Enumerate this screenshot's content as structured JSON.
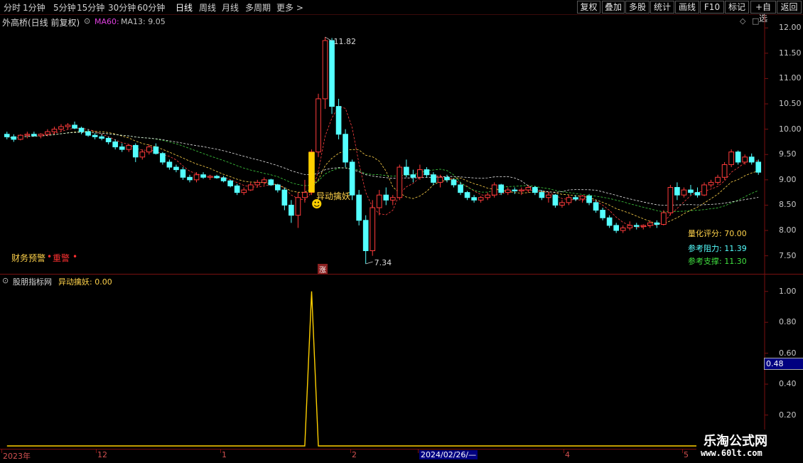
{
  "toolbar": {
    "periods": [
      "分时",
      "1分钟",
      "5分钟",
      "15分钟",
      "30分钟",
      "60分钟",
      "日线",
      "周线",
      "月线",
      "多周期",
      "更多 >"
    ],
    "active_period": "日线",
    "buttons": [
      "复权",
      "叠加",
      "多股",
      "统计",
      "画线",
      "F10",
      "标记",
      "+自选",
      "返回"
    ]
  },
  "main": {
    "title": "外高桥(日线 前复权)",
    "ma_label": "MA60:",
    "ma_value": "MA13: 9.05",
    "high_label": "11.82",
    "low_label": "7.34",
    "signal_label": "异动擒妖",
    "warning_label": "财务预警",
    "warning_value": "重警",
    "badge": "涨",
    "score_label": "量化评分: 70.00",
    "resistance_label": "参考阻力: 11.39",
    "support_label": "参考支撑: 11.30",
    "y_ticks": [
      "12.00",
      "11.50",
      "11.00",
      "10.50",
      "10.00",
      "9.50",
      "9.00",
      "8.50",
      "8.00",
      "7.50"
    ]
  },
  "sub": {
    "title": "股朋指标网",
    "series_label": "异动擒妖: 0.00",
    "y_ticks": [
      "1.00",
      "0.80",
      "0.60",
      "0.40",
      "0.20"
    ],
    "cursor_value": "0.48"
  },
  "date_axis": {
    "labels": [
      "2023年",
      "12",
      "1",
      "2",
      "2024/02/26/—",
      "4",
      "5"
    ]
  },
  "watermark": {
    "title": "乐淘公式网",
    "url": "www.60lt.com"
  },
  "colors": {
    "up": "#ff3b3b",
    "down": "#54ffff",
    "signal": "#ffd000",
    "ma1": "#e8e8e8",
    "ma2": "#ffd24a",
    "ma3": "#40d040",
    "ma4": "#ff4040"
  },
  "chart_data": {
    "type": "candlestick",
    "ylim": [
      7.2,
      12.2
    ],
    "candles": [
      [
        9.9,
        9.95,
        9.8,
        9.85
      ],
      [
        9.85,
        9.9,
        9.75,
        9.8
      ],
      [
        9.8,
        9.9,
        9.78,
        9.88
      ],
      [
        9.88,
        9.95,
        9.82,
        9.9
      ],
      [
        9.9,
        9.95,
        9.85,
        9.87
      ],
      [
        9.87,
        9.92,
        9.82,
        9.9
      ],
      [
        9.9,
        10.0,
        9.86,
        9.95
      ],
      [
        9.95,
        10.05,
        9.9,
        10.0
      ],
      [
        10.0,
        10.1,
        9.95,
        10.05
      ],
      [
        10.05,
        10.12,
        10.0,
        10.08
      ],
      [
        10.08,
        10.15,
        10.0,
        10.02
      ],
      [
        10.02,
        10.05,
        9.9,
        9.95
      ],
      [
        9.95,
        10.0,
        9.85,
        9.88
      ],
      [
        9.88,
        9.92,
        9.8,
        9.85
      ],
      [
        9.85,
        9.9,
        9.78,
        9.82
      ],
      [
        9.82,
        9.85,
        9.7,
        9.75
      ],
      [
        9.75,
        9.8,
        9.6,
        9.65
      ],
      [
        9.65,
        9.72,
        9.55,
        9.6
      ],
      [
        9.6,
        9.7,
        9.55,
        9.68
      ],
      [
        9.68,
        9.72,
        9.35,
        9.45
      ],
      [
        9.45,
        9.6,
        9.4,
        9.55
      ],
      [
        9.55,
        9.7,
        9.5,
        9.65
      ],
      [
        9.65,
        9.72,
        9.5,
        9.52
      ],
      [
        9.52,
        9.55,
        9.3,
        9.35
      ],
      [
        9.35,
        9.4,
        9.2,
        9.25
      ],
      [
        9.25,
        9.3,
        9.15,
        9.2
      ],
      [
        9.2,
        9.25,
        9.0,
        9.05
      ],
      [
        9.05,
        9.1,
        8.95,
        9.0
      ],
      [
        9.0,
        9.15,
        8.95,
        9.1
      ],
      [
        9.1,
        9.15,
        9.02,
        9.05
      ],
      [
        9.05,
        9.1,
        9.0,
        9.07
      ],
      [
        9.07,
        9.1,
        9.02,
        9.04
      ],
      [
        9.04,
        9.08,
        8.95,
        8.98
      ],
      [
        8.98,
        9.0,
        8.85,
        8.88
      ],
      [
        8.88,
        8.92,
        8.7,
        8.75
      ],
      [
        8.75,
        8.85,
        8.7,
        8.8
      ],
      [
        8.8,
        8.95,
        8.78,
        8.9
      ],
      [
        8.9,
        9.0,
        8.85,
        8.95
      ],
      [
        8.95,
        9.05,
        8.9,
        9.0
      ],
      [
        9.0,
        9.02,
        8.88,
        8.9
      ],
      [
        8.9,
        8.92,
        8.75,
        8.8
      ],
      [
        8.8,
        8.85,
        8.4,
        8.5
      ],
      [
        8.5,
        8.6,
        8.15,
        8.3
      ],
      [
        8.3,
        8.75,
        8.05,
        8.65
      ],
      [
        8.65,
        9.0,
        8.55,
        8.75
      ],
      [
        8.75,
        9.6,
        8.7,
        9.55
      ],
      [
        9.55,
        10.7,
        9.45,
        10.6
      ],
      [
        10.6,
        11.82,
        10.4,
        11.75
      ],
      [
        11.75,
        11.8,
        10.3,
        10.45
      ],
      [
        10.45,
        10.6,
        9.8,
        9.9
      ],
      [
        9.9,
        10.0,
        9.25,
        9.35
      ],
      [
        9.35,
        9.4,
        8.6,
        8.7
      ],
      [
        8.7,
        8.8,
        8.1,
        8.2
      ],
      [
        8.2,
        8.3,
        7.34,
        7.6
      ],
      [
        7.6,
        8.6,
        7.5,
        8.45
      ],
      [
        8.45,
        8.8,
        8.3,
        8.7
      ],
      [
        8.7,
        8.85,
        8.5,
        8.6
      ],
      [
        8.6,
        8.7,
        8.5,
        8.65
      ],
      [
        8.65,
        9.3,
        8.6,
        9.25
      ],
      [
        9.25,
        9.4,
        9.05,
        9.1
      ],
      [
        9.1,
        9.2,
        8.95,
        9.05
      ],
      [
        9.05,
        9.3,
        9.0,
        9.2
      ],
      [
        9.2,
        9.25,
        9.05,
        9.1
      ],
      [
        9.1,
        9.15,
        8.9,
        8.95
      ],
      [
        8.95,
        9.1,
        8.85,
        9.05
      ],
      [
        9.05,
        9.1,
        8.95,
        9.0
      ],
      [
        9.0,
        9.02,
        8.85,
        8.9
      ],
      [
        8.9,
        8.95,
        8.7,
        8.75
      ],
      [
        8.75,
        8.78,
        8.6,
        8.65
      ],
      [
        8.65,
        8.7,
        8.55,
        8.6
      ],
      [
        8.6,
        8.68,
        8.55,
        8.65
      ],
      [
        8.65,
        8.75,
        8.6,
        8.7
      ],
      [
        8.7,
        8.95,
        8.65,
        8.9
      ],
      [
        8.9,
        8.92,
        8.7,
        8.75
      ],
      [
        8.75,
        8.85,
        8.7,
        8.8
      ],
      [
        8.8,
        8.85,
        8.72,
        8.78
      ],
      [
        8.78,
        8.85,
        8.7,
        8.8
      ],
      [
        8.8,
        8.9,
        8.75,
        8.85
      ],
      [
        8.85,
        8.88,
        8.7,
        8.75
      ],
      [
        8.75,
        8.8,
        8.6,
        8.65
      ],
      [
        8.65,
        8.75,
        8.55,
        8.7
      ],
      [
        8.7,
        8.72,
        8.45,
        8.5
      ],
      [
        8.5,
        8.6,
        8.45,
        8.55
      ],
      [
        8.55,
        8.7,
        8.5,
        8.65
      ],
      [
        8.65,
        8.7,
        8.58,
        8.62
      ],
      [
        8.62,
        8.7,
        8.55,
        8.68
      ],
      [
        8.68,
        8.72,
        8.5,
        8.55
      ],
      [
        8.55,
        8.6,
        8.35,
        8.4
      ],
      [
        8.4,
        8.45,
        8.2,
        8.25
      ],
      [
        8.25,
        8.3,
        8.05,
        8.1
      ],
      [
        8.1,
        8.15,
        7.95,
        8.0
      ],
      [
        8.0,
        8.1,
        7.95,
        8.05
      ],
      [
        8.05,
        8.18,
        8.0,
        8.1
      ],
      [
        8.1,
        8.15,
        8.02,
        8.08
      ],
      [
        8.08,
        8.12,
        8.02,
        8.1
      ],
      [
        8.1,
        8.2,
        8.05,
        8.15
      ],
      [
        8.15,
        8.2,
        8.05,
        8.12
      ],
      [
        8.12,
        8.4,
        8.1,
        8.35
      ],
      [
        8.35,
        8.9,
        8.3,
        8.85
      ],
      [
        8.85,
        8.95,
        8.6,
        8.7
      ],
      [
        8.7,
        8.85,
        8.65,
        8.8
      ],
      [
        8.8,
        8.9,
        8.7,
        8.75
      ],
      [
        8.75,
        8.85,
        8.65,
        8.7
      ],
      [
        8.7,
        8.95,
        8.68,
        8.9
      ],
      [
        8.9,
        9.0,
        8.85,
        8.95
      ],
      [
        8.95,
        9.1,
        8.9,
        9.05
      ],
      [
        9.05,
        9.35,
        9.0,
        9.3
      ],
      [
        9.3,
        9.6,
        9.25,
        9.55
      ],
      [
        9.55,
        9.58,
        9.3,
        9.35
      ],
      [
        9.35,
        9.5,
        9.3,
        9.45
      ],
      [
        9.45,
        9.52,
        9.3,
        9.35
      ],
      [
        9.35,
        9.4,
        9.1,
        9.15
      ]
    ],
    "signal": [
      0,
      0,
      0,
      0,
      0,
      0,
      0,
      0,
      0,
      0,
      0,
      0,
      0,
      0,
      0,
      0,
      0,
      0,
      0,
      0,
      0,
      0,
      0,
      0,
      0,
      0,
      0,
      0,
      0,
      0,
      0,
      0,
      0,
      0,
      0,
      0,
      0,
      0,
      0,
      0,
      0,
      0,
      0,
      0,
      0,
      1,
      0,
      0,
      0,
      0,
      0,
      0,
      0,
      0,
      0,
      0,
      0,
      0,
      0,
      0,
      0,
      0,
      0,
      0,
      0,
      0,
      0,
      0,
      0,
      0,
      0,
      0,
      0,
      0,
      0,
      0,
      0,
      0,
      0,
      0,
      0,
      0,
      0,
      0,
      0,
      0,
      0,
      0,
      0,
      0,
      0,
      0,
      0,
      0,
      0,
      0,
      0,
      0,
      0,
      0,
      0,
      0,
      0,
      0,
      0,
      0,
      0,
      0,
      0,
      0,
      0,
      0,
      0
    ],
    "sub_ylim": [
      0,
      1.1
    ]
  }
}
